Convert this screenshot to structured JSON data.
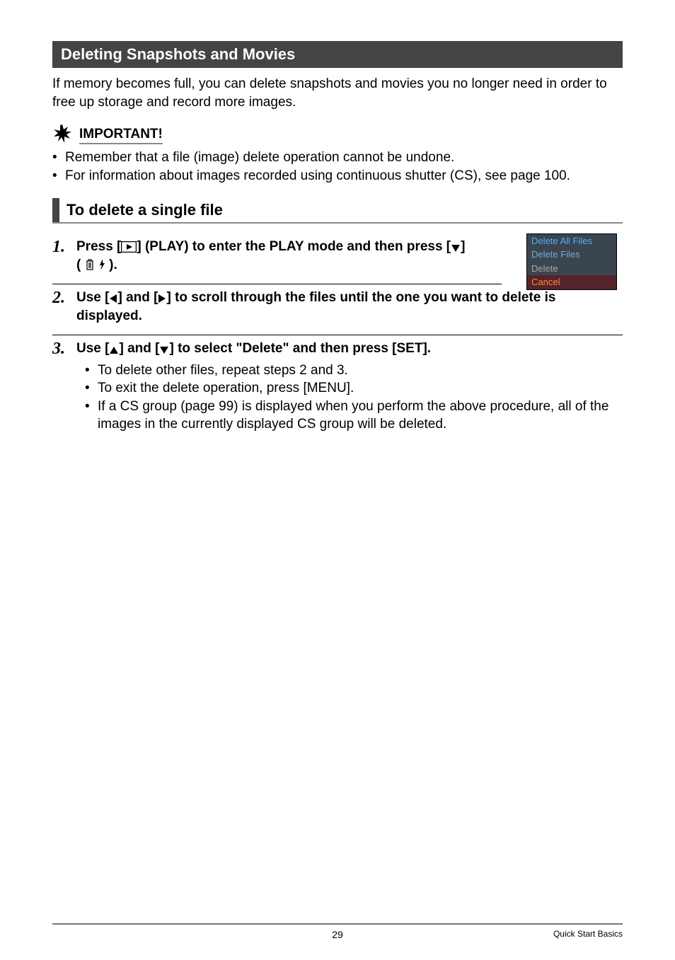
{
  "section_title": "Deleting Snapshots and Movies",
  "intro": "If memory becomes full, you can delete snapshots and movies you no longer need in order to free up storage and record more images.",
  "important_label": "IMPORTANT!",
  "important_bullets": [
    "Remember that a file (image) delete operation cannot be undone.",
    "For information about images recorded using continuous shutter (CS), see page 100."
  ],
  "subheader": "To delete a single file",
  "steps": {
    "s1": {
      "num": "1.",
      "pre": "Press [",
      "mid": "] (PLAY) to enter the PLAY mode and then press [",
      "mid2": "] (",
      "post": ")."
    },
    "s2": {
      "num": "2.",
      "pre": "Use [",
      "mid": "] and [",
      "post": "] to scroll through the files until the one you want to delete is displayed."
    },
    "s3": {
      "num": "3.",
      "pre": "Use [",
      "mid": "] and [",
      "post": "] to select \"Delete\" and then press [SET].",
      "sub": [
        "To delete other files, repeat steps 2 and 3.",
        "To exit the delete operation, press [MENU].",
        "If a CS group (page 99) is displayed when you perform the above procedure, all of the images in the currently displayed CS group will be deleted."
      ]
    }
  },
  "delete_menu": {
    "i1": "Delete All Files",
    "i2": "Delete Files",
    "i3": "Delete",
    "i4": "Cancel"
  },
  "footer": {
    "page": "29",
    "section": "Quick Start Basics"
  }
}
